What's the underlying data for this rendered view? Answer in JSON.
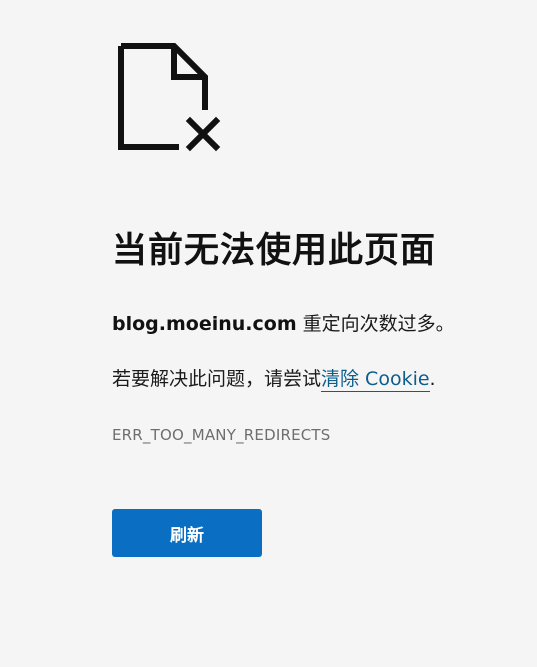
{
  "error_icon": "broken-page-icon",
  "title": "当前无法使用此页面",
  "message": {
    "domain": "blog.moeinu.com",
    "text": " 重定向次数过多。"
  },
  "suggestion": {
    "prefix": "若要解决此问题，请尝试",
    "link_label": "清除 Cookie",
    "suffix": "."
  },
  "error_code": "ERR_TOO_MANY_REDIRECTS",
  "refresh_button_label": "刷新",
  "colors": {
    "background": "#f5f5f5",
    "button": "#0a6fc2",
    "link": "#0e5e8c",
    "error_code": "#6e6e6e"
  }
}
